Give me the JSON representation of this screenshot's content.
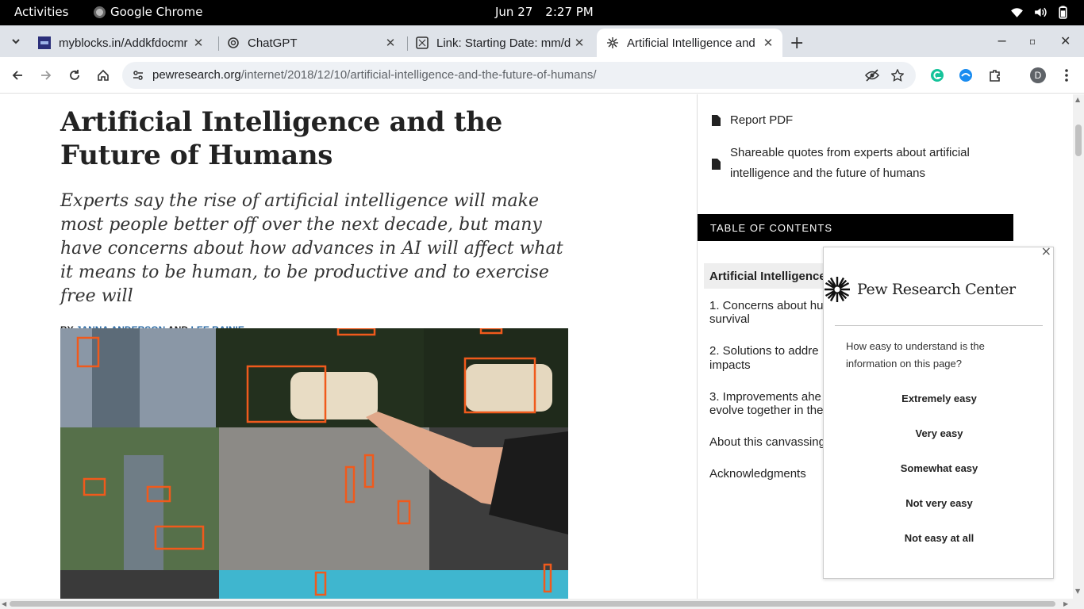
{
  "system_bar": {
    "activities": "Activities",
    "app_name": "Google Chrome",
    "date": "Jun 27",
    "time": "2:27 PM"
  },
  "tabs": [
    {
      "title": "myblocks.in/Addkfdocmr",
      "favicon": "myblocks-icon"
    },
    {
      "title": "ChatGPT",
      "favicon": "chatgpt-icon"
    },
    {
      "title": "Link: Starting Date: mm/d",
      "favicon": "link-icon"
    },
    {
      "title": "Artificial Intelligence and",
      "favicon": "pew-icon",
      "active": true
    }
  ],
  "address_bar": {
    "domain": "pewresearch.org",
    "path": "/internet/2018/12/10/artificial-intelligence-and-the-future-of-humans/",
    "profile_initial": "D"
  },
  "article": {
    "title": "Artificial Intelligence and the Future of Humans",
    "dek": "Experts say the rise of artificial intelligence will make most people better off over the next decade, but many have concerns about how advances in AI will affect what it means to be human, to be productive and to exercise free will",
    "byline_prefix": "BY",
    "author1": "JANNA ANDERSON",
    "byline_and": "AND",
    "author2": "LEE RAINIE"
  },
  "sidebar": {
    "links": [
      "Report PDF",
      "Shareable quotes from experts about artificial intelligence and the future of humans"
    ],
    "toc_heading": "TABLE OF CONTENTS",
    "toc_items": [
      "Artificial Intelligence",
      "1. Concerns about hu",
      "survival",
      "2. Solutions to addre",
      "impacts",
      "3. Improvements ahe",
      "evolve together in the",
      "About this canvassing",
      "Acknowledgments"
    ]
  },
  "survey": {
    "brand": "Pew Research Center",
    "question": "How easy to understand is the information on this page?",
    "options": [
      "Extremely easy",
      "Very easy",
      "Somewhat easy",
      "Not very easy",
      "Not easy at all"
    ],
    "close": "×"
  },
  "colors": {
    "link_blue": "#2a6aa4",
    "tabstrip": "#dfe3e9",
    "toc_bar": "#000000"
  }
}
